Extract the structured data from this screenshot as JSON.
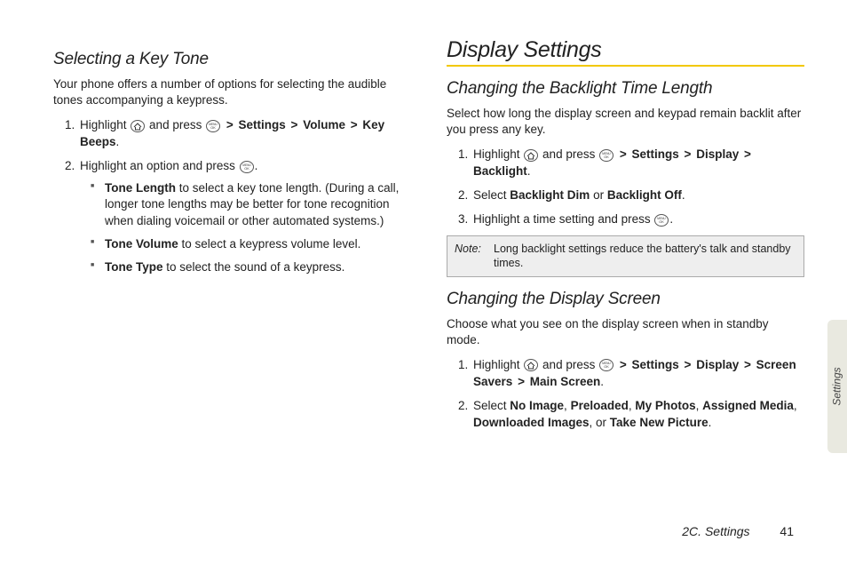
{
  "left": {
    "h2": "Selecting a Key Tone",
    "intro": "Your phone offers a number of options for selecting the audible tones accompanying a keypress.",
    "step1_pre": "Highlight ",
    "step1_mid": " and press ",
    "step1_path": [
      "Settings",
      "Volume",
      "Key Beeps"
    ],
    "step2_pre": "Highlight an option and press ",
    "step2_post": ".",
    "b1_lead": "Tone Length",
    "b1_rest": " to select a key tone length. (During a call, longer tone lengths may be better for tone recognition when dialing voicemail or other automated systems.)",
    "b2_lead": "Tone Volume",
    "b2_rest": " to select a keypress volume level.",
    "b3_lead": "Tone Type",
    "b3_rest": " to select the sound of a keypress."
  },
  "right": {
    "h1": "Display Settings",
    "s1_h2": "Changing the Backlight Time Length",
    "s1_intro": "Select how long the display screen and keypad remain backlit after you press any key.",
    "s1_step1_pre": "Highlight ",
    "s1_step1_mid": " and press ",
    "s1_step1_path": [
      "Settings",
      "Display",
      "Backlight"
    ],
    "s1_step2_pre": "Select ",
    "s1_step2_a": "Backlight Dim",
    "s1_step2_or": " or ",
    "s1_step2_b": "Backlight Off",
    "s1_step2_post": ".",
    "s1_step3_pre": "Highlight a time setting and press ",
    "s1_step3_post": ".",
    "note_label": "Note:",
    "note_text": "Long backlight settings reduce the battery's talk and standby times.",
    "s2_h2": "Changing the Display Screen",
    "s2_intro": "Choose what you see on the display screen when in standby mode.",
    "s2_step1_pre": "Highlight ",
    "s2_step1_mid": " and press ",
    "s2_step1_path": [
      "Settings",
      "Display",
      "Screen Savers",
      "Main Screen"
    ],
    "s2_step2_pre": "Select ",
    "s2_step2_opts": [
      "No Image",
      "Preloaded",
      "My Photos",
      "Assigned Media",
      "Downloaded Images"
    ],
    "s2_step2_or": ", or ",
    "s2_step2_last": "Take New Picture",
    "s2_step2_post": "."
  },
  "tab": "Settings",
  "footer_section": "2C. Settings",
  "footer_page": "41"
}
